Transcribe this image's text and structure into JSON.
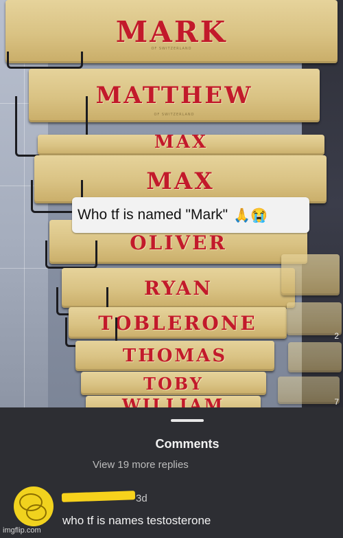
{
  "photo": {
    "boxes": [
      {
        "id": "mark",
        "name": "MARK"
      },
      {
        "id": "matthew",
        "name": "MATTHEW"
      },
      {
        "id": "max-top",
        "name": "MAX"
      },
      {
        "id": "max",
        "name": "MAX"
      },
      {
        "id": "oliver",
        "name": "OLIVER"
      },
      {
        "id": "ryan",
        "name": "RYAN"
      },
      {
        "id": "toblerone",
        "name": "TOBLERONE"
      },
      {
        "id": "thomas",
        "name": "THOMAS"
      },
      {
        "id": "toby",
        "name": "TOBY"
      },
      {
        "id": "william",
        "name": "WILLIAM"
      }
    ],
    "box_subtext": "OF SWITZERLAND",
    "caption": "Who tf is named \"Mark\"",
    "caption_emoji": "🙏😭",
    "edge_numbers": [
      "2",
      "7"
    ]
  },
  "comments": {
    "title": "Comments",
    "view_more": "View 19 more replies",
    "comment": {
      "avatar_icon": "yellow-avatar-icon",
      "timestamp": "3d",
      "text": "who tf is names testosterone"
    }
  },
  "watermark": "imgflip.com"
}
